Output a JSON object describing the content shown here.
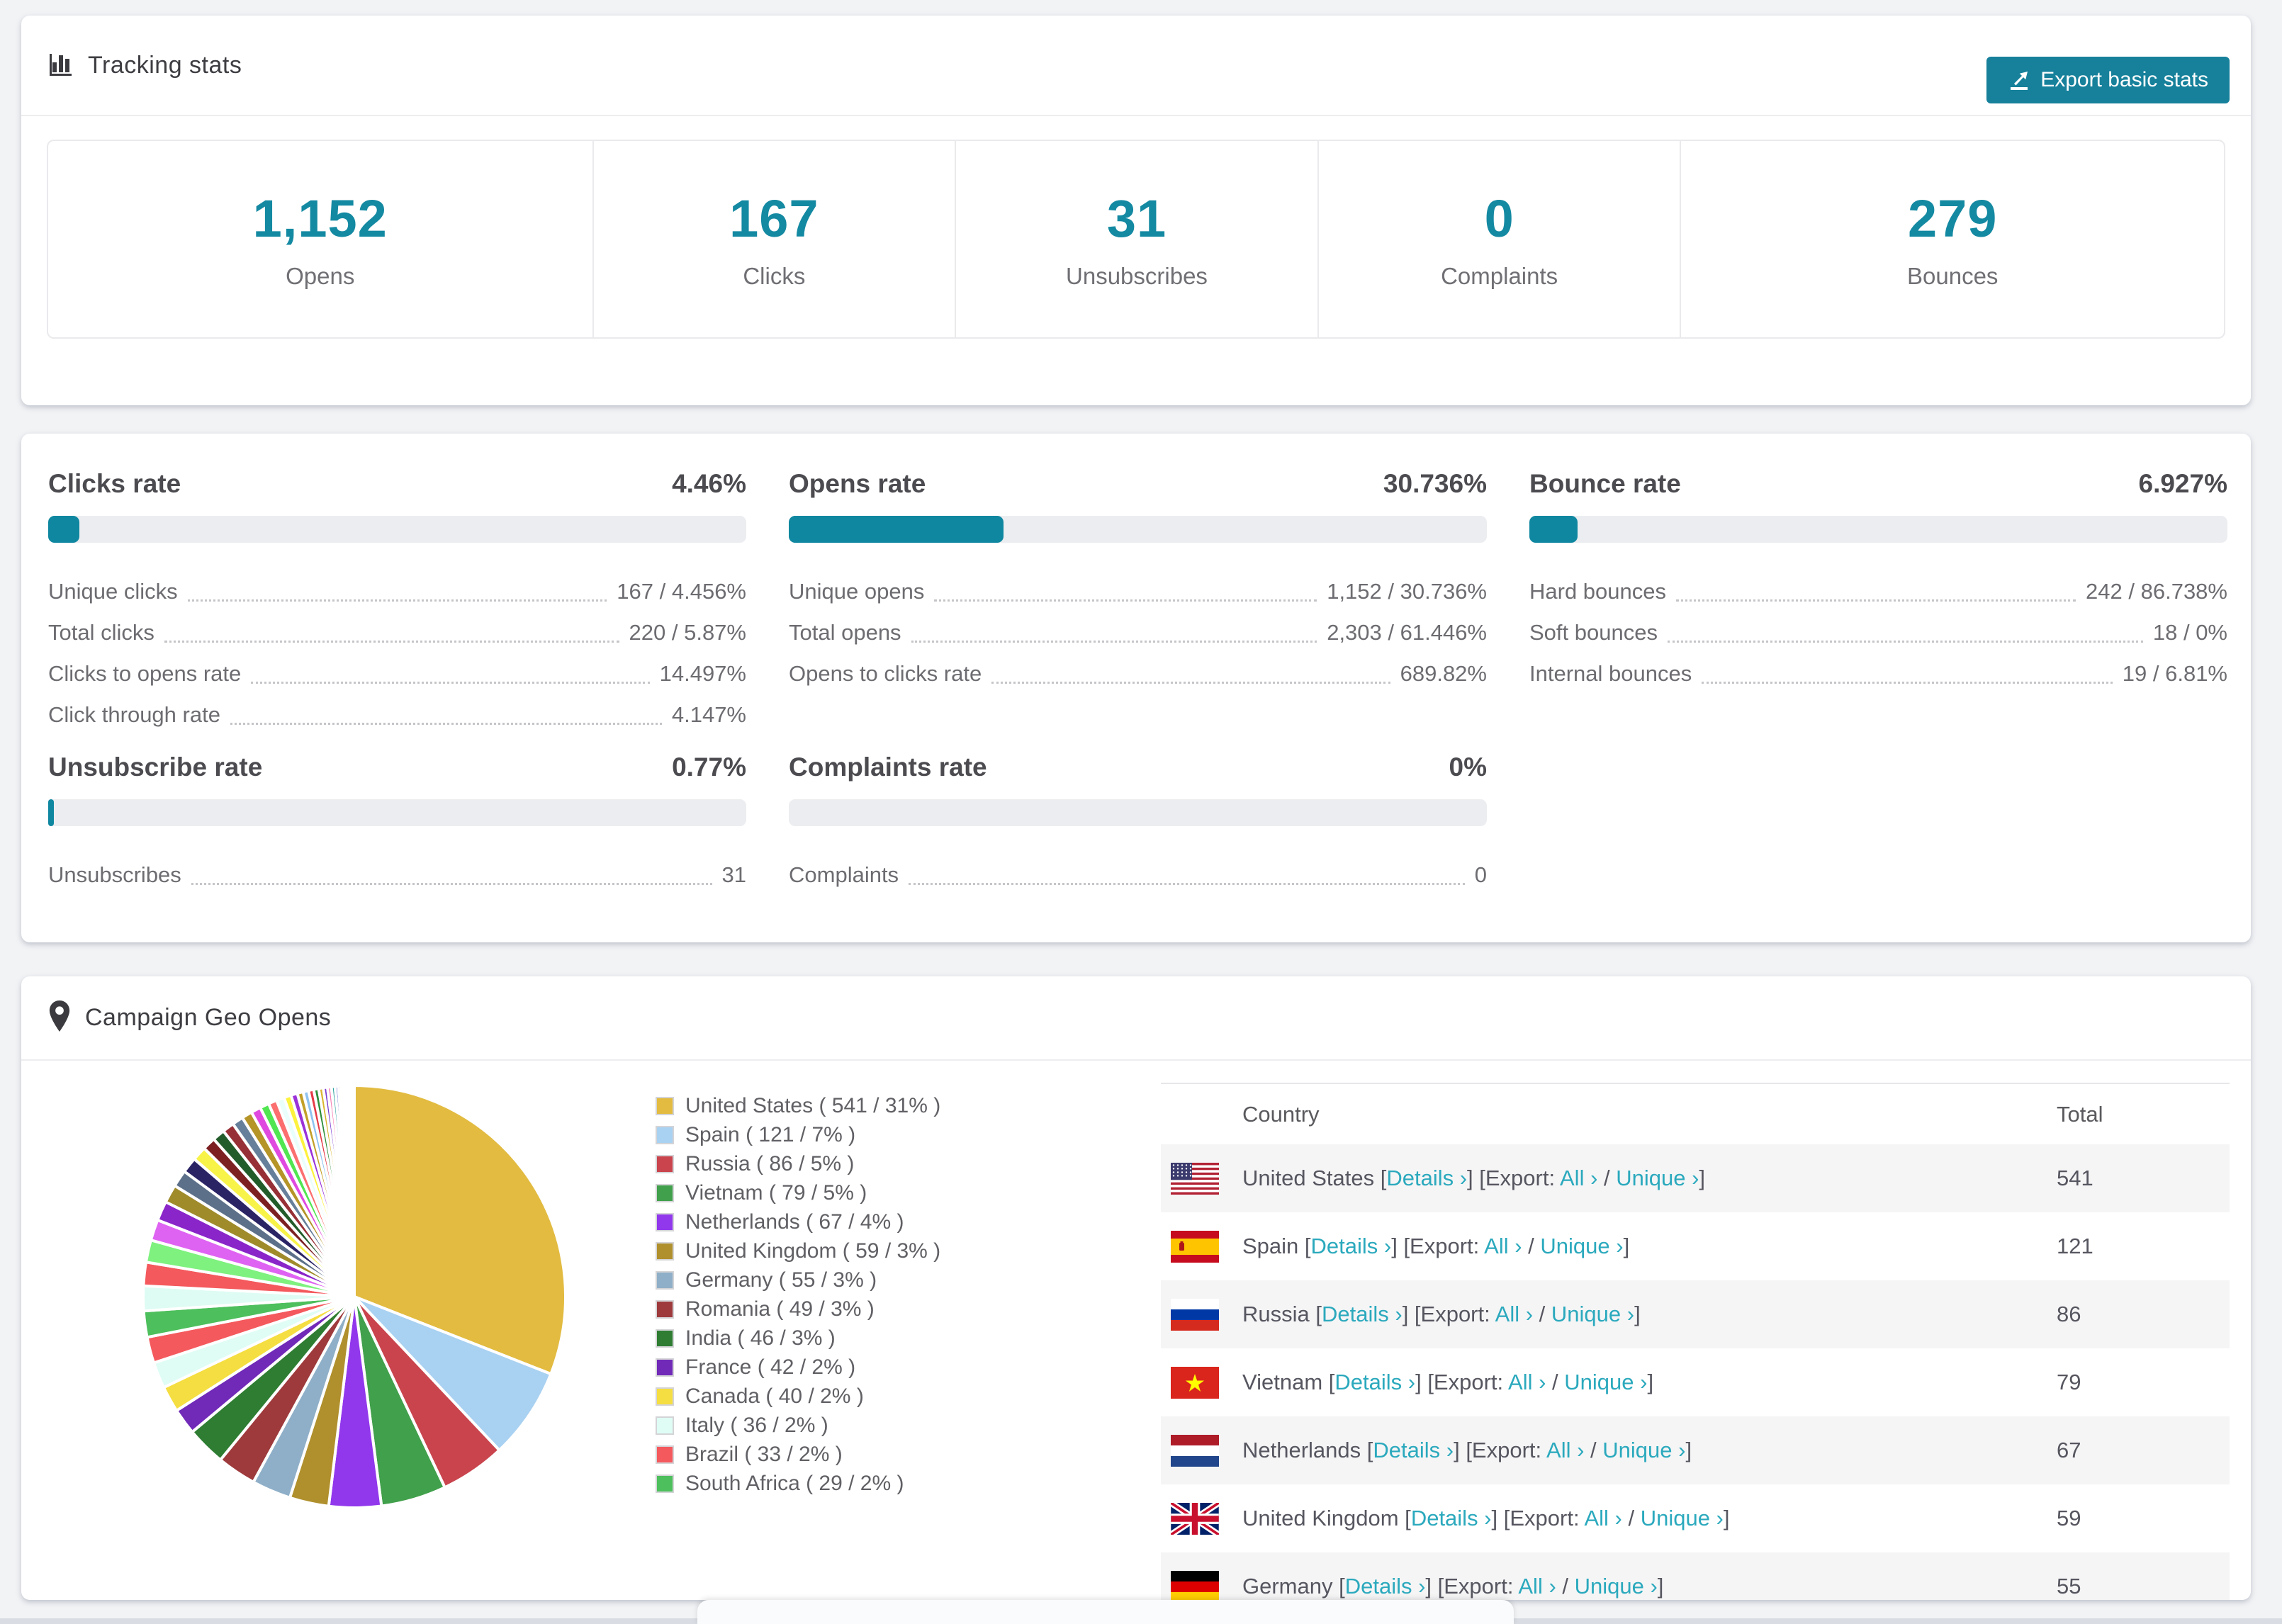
{
  "tracking_card": {
    "title": "Tracking stats",
    "export_button": "Export basic stats",
    "stats": [
      {
        "value": "1,152",
        "label": "Opens"
      },
      {
        "value": "167",
        "label": "Clicks"
      },
      {
        "value": "31",
        "label": "Unsubscribes"
      },
      {
        "value": "0",
        "label": "Complaints"
      },
      {
        "value": "279",
        "label": "Bounces"
      }
    ]
  },
  "rates_card": {
    "sections": [
      {
        "title": "Clicks rate",
        "value": "4.46%",
        "percent": 4.46,
        "col": 0,
        "row": 0,
        "rows": [
          {
            "label": "Unique clicks",
            "value": "167 / 4.456%"
          },
          {
            "label": "Total clicks",
            "value": "220 / 5.87%"
          },
          {
            "label": "Clicks to opens rate",
            "value": "14.497%"
          },
          {
            "label": "Click through rate",
            "value": "4.147%"
          }
        ]
      },
      {
        "title": "Opens rate",
        "value": "30.736%",
        "percent": 30.736,
        "col": 1,
        "row": 0,
        "rows": [
          {
            "label": "Unique opens",
            "value": "1,152 / 30.736%"
          },
          {
            "label": "Total opens",
            "value": "2,303 / 61.446%"
          },
          {
            "label": "Opens to clicks rate",
            "value": "689.82%"
          }
        ]
      },
      {
        "title": "Bounce rate",
        "value": "6.927%",
        "percent": 6.927,
        "col": 2,
        "row": 0,
        "rows": [
          {
            "label": "Hard bounces",
            "value": "242 / 86.738%"
          },
          {
            "label": "Soft bounces",
            "value": "18 / 0%"
          },
          {
            "label": "Internal bounces",
            "value": "19 / 6.81%"
          }
        ]
      },
      {
        "title": "Unsubscribe rate",
        "value": "0.77%",
        "percent": 0.77,
        "col": 0,
        "row": 1,
        "rows": [
          {
            "label": "Unsubscribes",
            "value": "31"
          }
        ]
      },
      {
        "title": "Complaints rate",
        "value": "0%",
        "percent": 0,
        "col": 1,
        "row": 1,
        "rows": [
          {
            "label": "Complaints",
            "value": "0"
          }
        ]
      }
    ]
  },
  "geo_card": {
    "title": "Campaign Geo Opens",
    "chart_data": {
      "type": "pie",
      "title": "Campaign Geo Opens",
      "legend_position": "right",
      "series": [
        {
          "name": "United States",
          "count": 541,
          "percent": 31,
          "color": "#E2BB40",
          "flag": "us"
        },
        {
          "name": "Spain",
          "count": 121,
          "percent": 7,
          "color": "#A9D1F1",
          "flag": "es"
        },
        {
          "name": "Russia",
          "count": 86,
          "percent": 5,
          "color": "#C9444D",
          "flag": "ru"
        },
        {
          "name": "Vietnam",
          "count": 79,
          "percent": 5,
          "color": "#41A04B",
          "flag": "vn"
        },
        {
          "name": "Netherlands",
          "count": 67,
          "percent": 4,
          "color": "#9137EC",
          "flag": "nl"
        },
        {
          "name": "United Kingdom",
          "count": 59,
          "percent": 3,
          "color": "#B0902D",
          "flag": "gb"
        },
        {
          "name": "Germany",
          "count": 55,
          "percent": 3,
          "color": "#8FAFC8",
          "flag": "de"
        },
        {
          "name": "Romania",
          "count": 49,
          "percent": 3,
          "color": "#9E3A3C",
          "flag": "ro"
        },
        {
          "name": "India",
          "count": 46,
          "percent": 3,
          "color": "#2E7D32",
          "flag": "in"
        },
        {
          "name": "France",
          "count": 42,
          "percent": 2,
          "color": "#7129B8",
          "flag": "fr"
        },
        {
          "name": "Canada",
          "count": 40,
          "percent": 2,
          "color": "#F5DE41",
          "flag": "ca"
        },
        {
          "name": "Italy",
          "count": 36,
          "percent": 2,
          "color": "#DFFDF5",
          "flag": "it"
        },
        {
          "name": "Brazil",
          "count": 33,
          "percent": 2,
          "color": "#F4595D",
          "flag": "br"
        },
        {
          "name": "South Africa",
          "count": 29,
          "percent": 2,
          "color": "#4DBF5C",
          "flag": "za"
        }
      ],
      "other_slices": {
        "percents": [
          1.9,
          1.8,
          1.7,
          1.6,
          1.5,
          1.4,
          1.3,
          1.2,
          1.1,
          1.0,
          0.95,
          0.9,
          0.85,
          0.8,
          0.75,
          0.7,
          0.65,
          0.6,
          0.55,
          0.5,
          0.45,
          0.42,
          0.4,
          0.38,
          0.35,
          0.32,
          0.3,
          0.28,
          0.25,
          0.22,
          0.2,
          0.17,
          0.14,
          0.12,
          0.1,
          0.08,
          0.06,
          0.05,
          0.04,
          0.03
        ],
        "colors": [
          "#defcf3",
          "#f4595d",
          "#7ef17e",
          "#df63f2",
          "#8a25c9",
          "#a08b2b",
          "#5c7089",
          "#2a2465",
          "#f8f348",
          "#7c2022",
          "#235c2b",
          "#973036",
          "#667f9a",
          "#b59428",
          "#e049e0",
          "#51e651",
          "#fb6f6f",
          "#eafffb",
          "#fdf23d",
          "#9a32d8",
          "#c3a028",
          "#8fc3f0",
          "#e43b47",
          "#2f8f3a",
          "#d9b62f",
          "#7d3fd1",
          "#f77fb4",
          "#2fa3a0",
          "#4a57c9",
          "#c9572f",
          "#7db32c",
          "#2c6bb3",
          "#b32c8a",
          "#e0e052",
          "#52b3e0",
          "#a35252",
          "#52a37a",
          "#8a8a2c",
          "#d952a3",
          "#6fd9d1"
        ]
      }
    },
    "table": {
      "headers": [
        "Country",
        "Total"
      ],
      "link_words": {
        "details": "Details",
        "export": "Export:",
        "all": "All",
        "unique": "Unique",
        "chev": "›"
      },
      "rows": [
        {
          "country": "United States",
          "flag": "us",
          "total": "541"
        },
        {
          "country": "Spain",
          "flag": "es",
          "total": "121"
        },
        {
          "country": "Russia",
          "flag": "ru",
          "total": "86"
        },
        {
          "country": "Vietnam",
          "flag": "vn",
          "total": "79"
        },
        {
          "country": "Netherlands",
          "flag": "nl",
          "total": "67"
        },
        {
          "country": "United Kingdom",
          "flag": "gb",
          "total": "59"
        },
        {
          "country": "Germany",
          "flag": "de",
          "total": "55"
        }
      ]
    }
  }
}
